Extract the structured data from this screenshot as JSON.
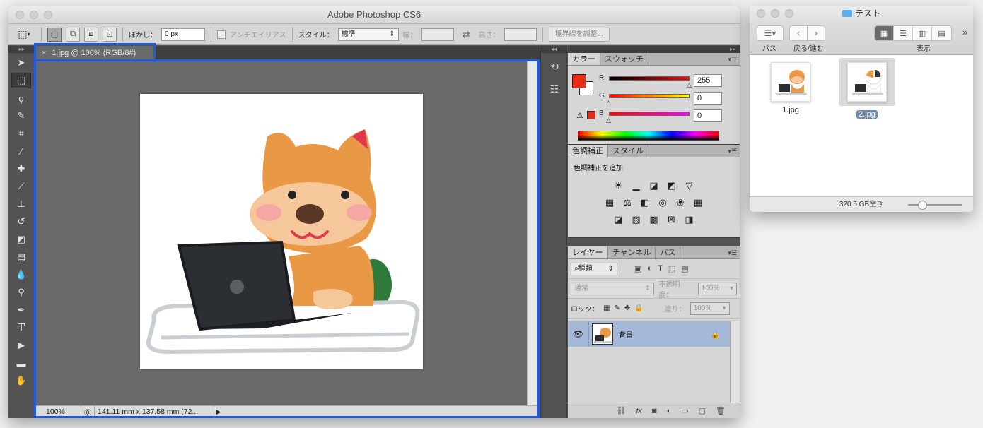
{
  "photoshop": {
    "window_title": "Adobe Photoshop CS6",
    "options": {
      "feather_label": "ぼかし：",
      "feather_value": "0 px",
      "antialias_label": "アンチエイリアス",
      "style_label": "スタイル：",
      "style_value": "標準",
      "width_label": "幅：",
      "height_label": "高さ：",
      "refine_edge_button": "境界線を調整..."
    },
    "document_tab": "1.jpg @ 100% (RGB/8#)",
    "status": {
      "zoom": "100%",
      "doc_info": "141.11 mm x 137.58 mm (72..."
    },
    "color_panel": {
      "tabs": [
        "カラー",
        "スウォッチ"
      ],
      "r_label": "R",
      "r_value": "255",
      "g_label": "G",
      "g_value": "0",
      "b_label": "B",
      "b_value": "0",
      "foreground_color": "#e62b17"
    },
    "adjustments_panel": {
      "tabs": [
        "色調補正",
        "スタイル"
      ],
      "title": "色調補正を追加"
    },
    "layers_panel": {
      "tabs": [
        "レイヤー",
        "チャンネル",
        "パス"
      ],
      "filter_kind": "種類",
      "blend_mode": "通常",
      "opacity_label": "不透明度：",
      "opacity_value": "100%",
      "lock_label": "ロック：",
      "fill_label": "塗り：",
      "fill_value": "100%",
      "layer_name": "背景"
    }
  },
  "finder": {
    "window_title": "テスト",
    "toolbar": {
      "path_label": "パス",
      "back_forward_label": "戻る/進む",
      "view_label": "表示"
    },
    "files": [
      {
        "name": "1.jpg",
        "selected": false
      },
      {
        "name": "2.jpg",
        "selected": true
      }
    ],
    "status_text": "320.5 GB空き"
  },
  "colors": {
    "highlight_border": "#1e5ae6",
    "selection_blue": "#6e89a9"
  }
}
